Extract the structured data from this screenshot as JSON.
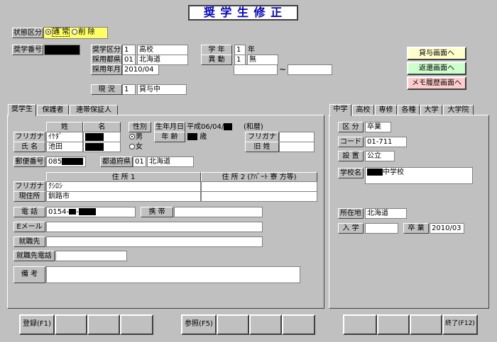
{
  "window_title": "奨 学 生 修 正",
  "status": {
    "label": "状態区分",
    "opt1": "通  常",
    "opt2": "削  除"
  },
  "scholar_no": {
    "label": "奨学番号"
  },
  "header": {
    "kubun_label": "奨学区分",
    "kubun_code": "1",
    "kubun_name": "高校",
    "pref_label": "採用都県",
    "pref_code": "01",
    "pref_name": "北海道",
    "ym_label": "採用年月",
    "ym_value": "2010/04",
    "grade_label": "学  年",
    "grade_value": "1",
    "grade_unit": "年",
    "change_label": "異  動",
    "change_code": "1",
    "change_name": "無",
    "tilde": "~",
    "state_label": "現  況",
    "state_code": "1",
    "state_name": "貸与中"
  },
  "side_buttons": {
    "loan": "貸与画面へ",
    "repay": "返還画面へ",
    "memo": "メモ履歴画面へ"
  },
  "left_tabs": [
    "奨学生",
    "保護者",
    "連帯保証人"
  ],
  "right_tabs": [
    "中学",
    "高校",
    "専修",
    "各種",
    "大学",
    "大学院"
  ],
  "student": {
    "sei_label": "姓",
    "mei_label": "名",
    "furigana_label": "フリガナ",
    "furigana_sei": "ｲｹﾀﾞ",
    "name_label": "氏  名",
    "name_sei": "池田",
    "gender_label": "性別",
    "male": "男",
    "female": "女",
    "birth_label": "生年月日",
    "birth_value": "平成06/04/",
    "era_note": "(和暦)",
    "age_label": "年  齢",
    "age_unit": "歳",
    "furigana2_label": "フリガナ",
    "old_name_label": "旧  姓",
    "postal_label": "郵便番号",
    "postal_value": "085",
    "pref_label": "都道府県",
    "pref_code": "01",
    "pref_name": "北海道",
    "addr1_header": "住 所 1",
    "addr2_header": "住 所 2 (ｱﾊﾟｰﾄ 寮 方等)",
    "addr_furigana_label": "フリガナ",
    "addr_furigana_value": "ｸｼﾛｼ",
    "addr_label": "現住所",
    "addr_value": "釧路市",
    "phone_label": "電  話",
    "phone_value": "0154-",
    "mobile_label": "携  帯",
    "email_label": "Eメール",
    "work_label": "就職先",
    "work_phone_label": "就職先電話",
    "notes_label": "備  考"
  },
  "school": {
    "kubun_label": "区  分",
    "kubun_value": "卒業",
    "code_label": "コード",
    "code_value": "01-711",
    "setup_label": "設  置",
    "setup_value": "公立",
    "name_label": "学校名",
    "name_value": "中学校",
    "loc_label": "所在地",
    "loc_value": "北海道",
    "enter_label": "入  学",
    "grad_label": "卒  業",
    "grad_value": "2010/03"
  },
  "bottom": {
    "register": "登録(F1)",
    "reference": "参照(F5)",
    "quit": "終了(F12)"
  },
  "colors": {
    "title_text": "#0000c0",
    "status_bg": "#ffff66",
    "btn_loan": "#ffffcc",
    "btn_repay": "#ccffcc",
    "btn_memo": "#ffcccc"
  }
}
